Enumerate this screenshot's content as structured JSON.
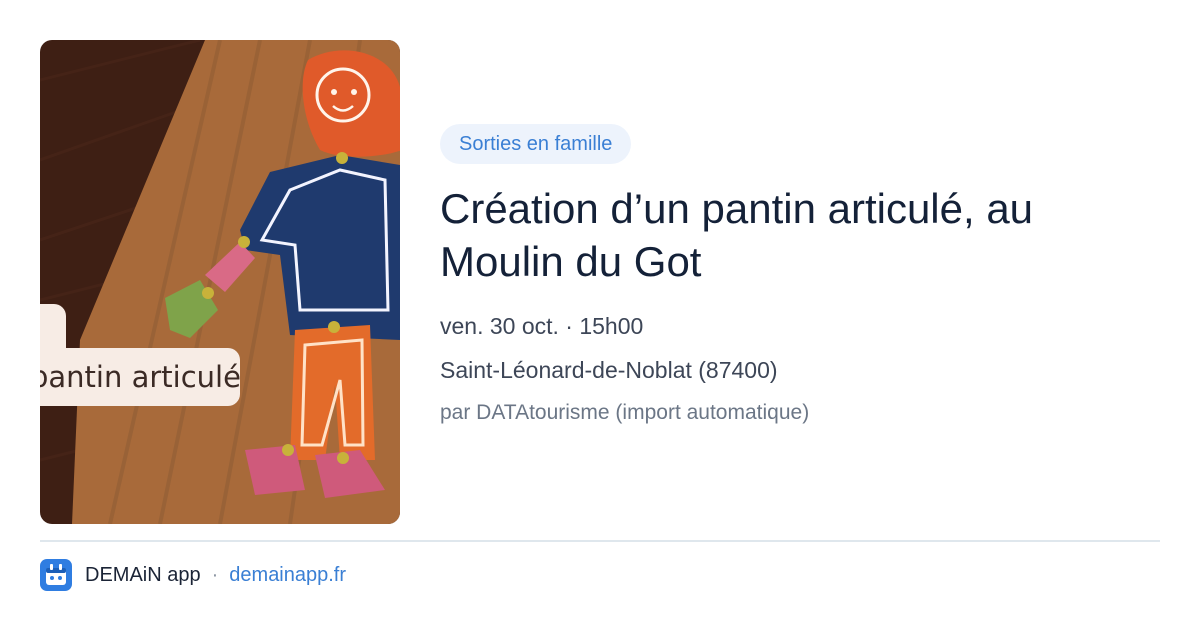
{
  "image": {
    "caption": "pantin articulé"
  },
  "badge": "Sorties en famille",
  "title": "Création d’un pantin articulé, au Moulin du Got",
  "date_time": "ven. 30 oct. · 15h00",
  "location": "Saint-Léonard-de-Noblat (87400)",
  "source": "par DATAtourisme (import automatique)",
  "footer": {
    "app_name": "DEMAiN app",
    "separator": "·",
    "domain": "demainapp.fr"
  },
  "colors": {
    "badge_bg": "#edf3fc",
    "accent": "#3a7fd4",
    "title": "#142138"
  },
  "icons": {
    "app": "demain-app-icon"
  }
}
